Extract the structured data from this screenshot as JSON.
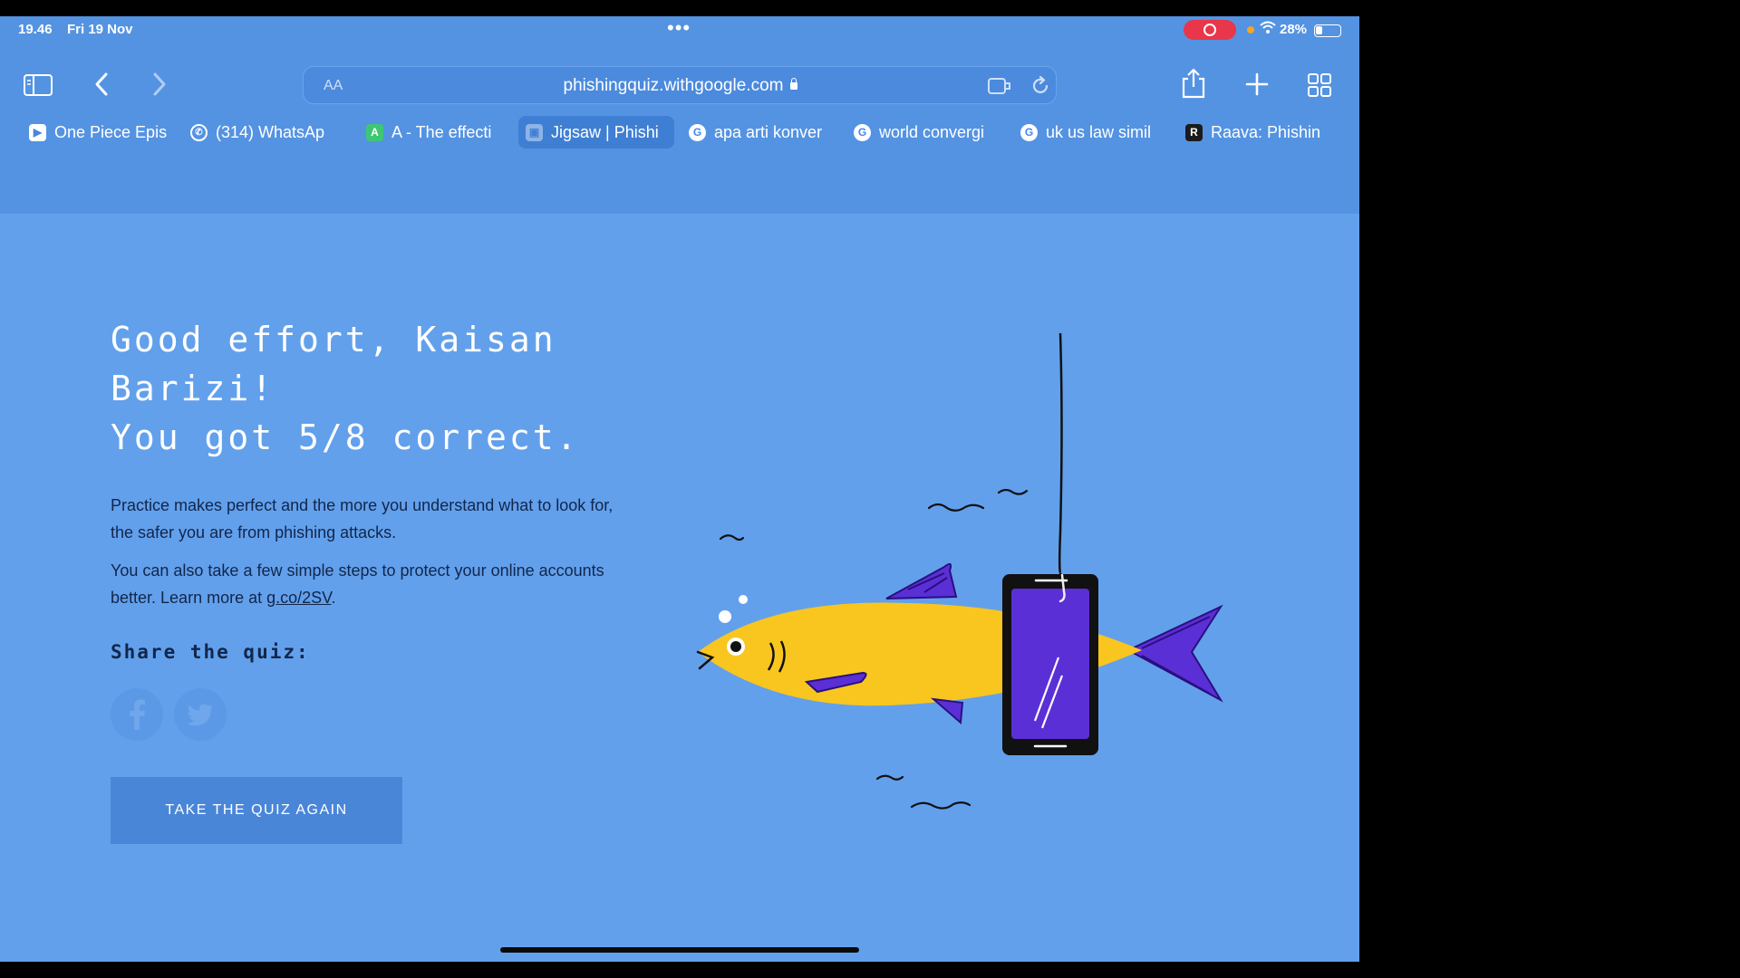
{
  "status_bar": {
    "time": "19.46",
    "date": "Fri 19 Nov",
    "battery": "28%"
  },
  "toolbar": {
    "reader_label": "AA",
    "url": "phishingquiz.withgoogle.com"
  },
  "tabs": [
    {
      "label": "One Piece Epis",
      "favicon": "op",
      "favicon_text": "▶",
      "active": false
    },
    {
      "label": "(314) WhatsAp",
      "favicon": "wa",
      "favicon_text": "✆",
      "active": false
    },
    {
      "label": "A - The effecti",
      "favicon": "a",
      "favicon_text": "A",
      "active": false
    },
    {
      "label": "Jigsaw | Phishi",
      "favicon": "jg",
      "favicon_text": "▣",
      "active": true
    },
    {
      "label": "apa arti konver",
      "favicon": "g",
      "favicon_text": "G",
      "active": false
    },
    {
      "label": "world convergi",
      "favicon": "g",
      "favicon_text": "G",
      "active": false
    },
    {
      "label": "uk us law simil",
      "favicon": "g",
      "favicon_text": "G",
      "active": false
    },
    {
      "label": "Raava: Phishin",
      "favicon": "r",
      "favicon_text": "R",
      "active": false
    }
  ],
  "result": {
    "line1": "Good effort, Kaisan",
    "line2": "Barizi!",
    "line3": "You got 5/8 correct.",
    "score_correct": 5,
    "score_total": 8
  },
  "body": {
    "para1": "Practice makes perfect and the more you understand what to look for, the safer you are from phishing attacks.",
    "para2_prefix": "You can also take a few simple steps to protect your online accounts better. Learn more at ",
    "para2_link": "g.co/2SV",
    "para2_suffix": "."
  },
  "share": {
    "label": "Share the quiz:"
  },
  "cta": {
    "retake_label": "TAKE THE QUIZ AGAIN"
  },
  "colors": {
    "page_bg": "#62a0ec",
    "chrome_bg": "#5493e2",
    "fish_body": "#f8c61e",
    "fin_purple": "#5b2fd6",
    "text_dark": "#12264a"
  }
}
